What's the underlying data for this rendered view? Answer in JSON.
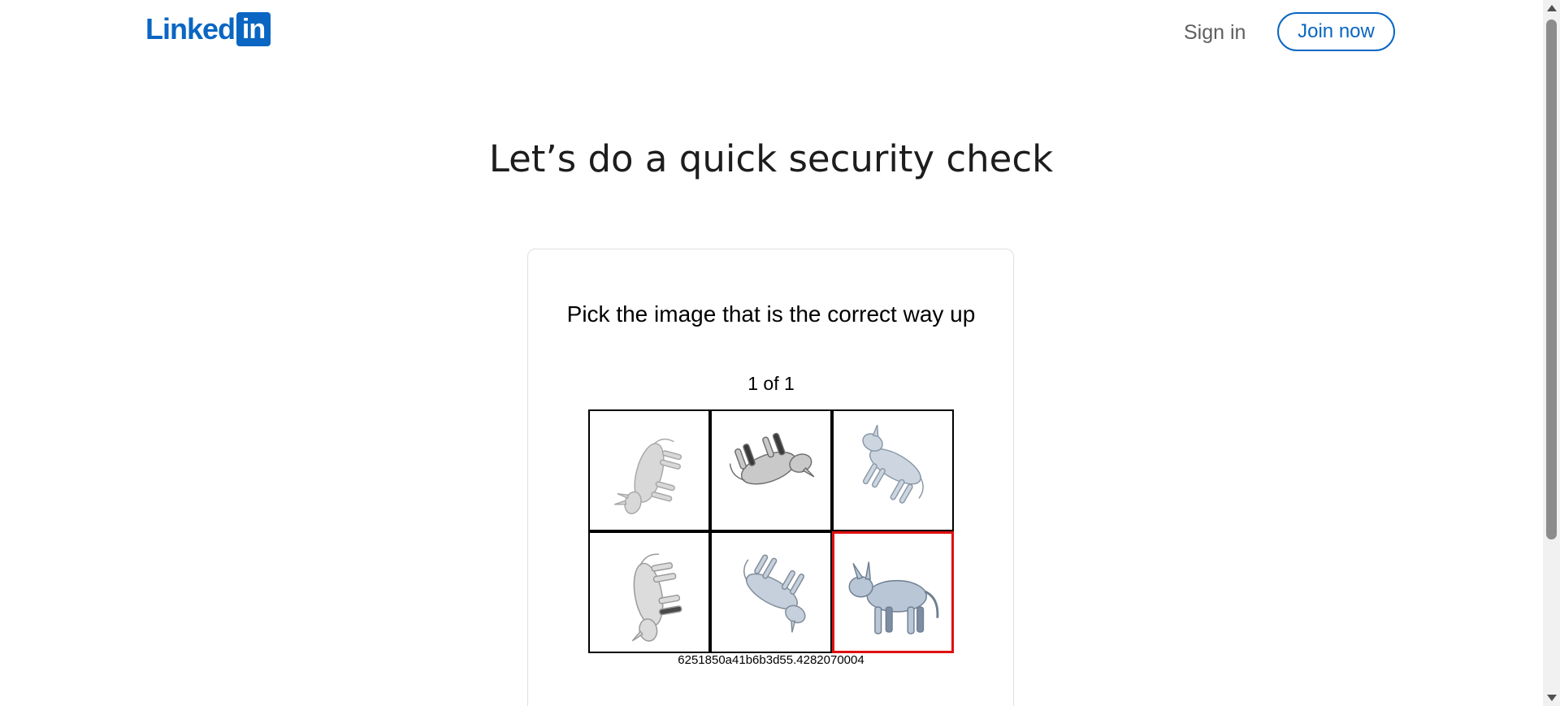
{
  "header": {
    "logo_text": "Linked",
    "logo_box_text": "in",
    "sign_in_label": "Sign in",
    "join_now_label": "Join now",
    "brand_color": "#0a66c2"
  },
  "main": {
    "title": "Let’s do a quick security check"
  },
  "challenge": {
    "prompt": "Pick the image that is the correct way up",
    "progress": "1 of 1",
    "selected_color": "#e01010",
    "tiles": [
      {
        "icon": "donkey-rotated-image",
        "selected": false
      },
      {
        "icon": "donkey-rotated-image",
        "selected": false
      },
      {
        "icon": "donkey-rotated-image",
        "selected": false
      },
      {
        "icon": "donkey-rotated-image",
        "selected": false
      },
      {
        "icon": "donkey-rotated-image",
        "selected": false
      },
      {
        "icon": "donkey-upright-image",
        "selected": true
      }
    ],
    "session_id": "6251850a41b6b3d55.4282070004"
  }
}
